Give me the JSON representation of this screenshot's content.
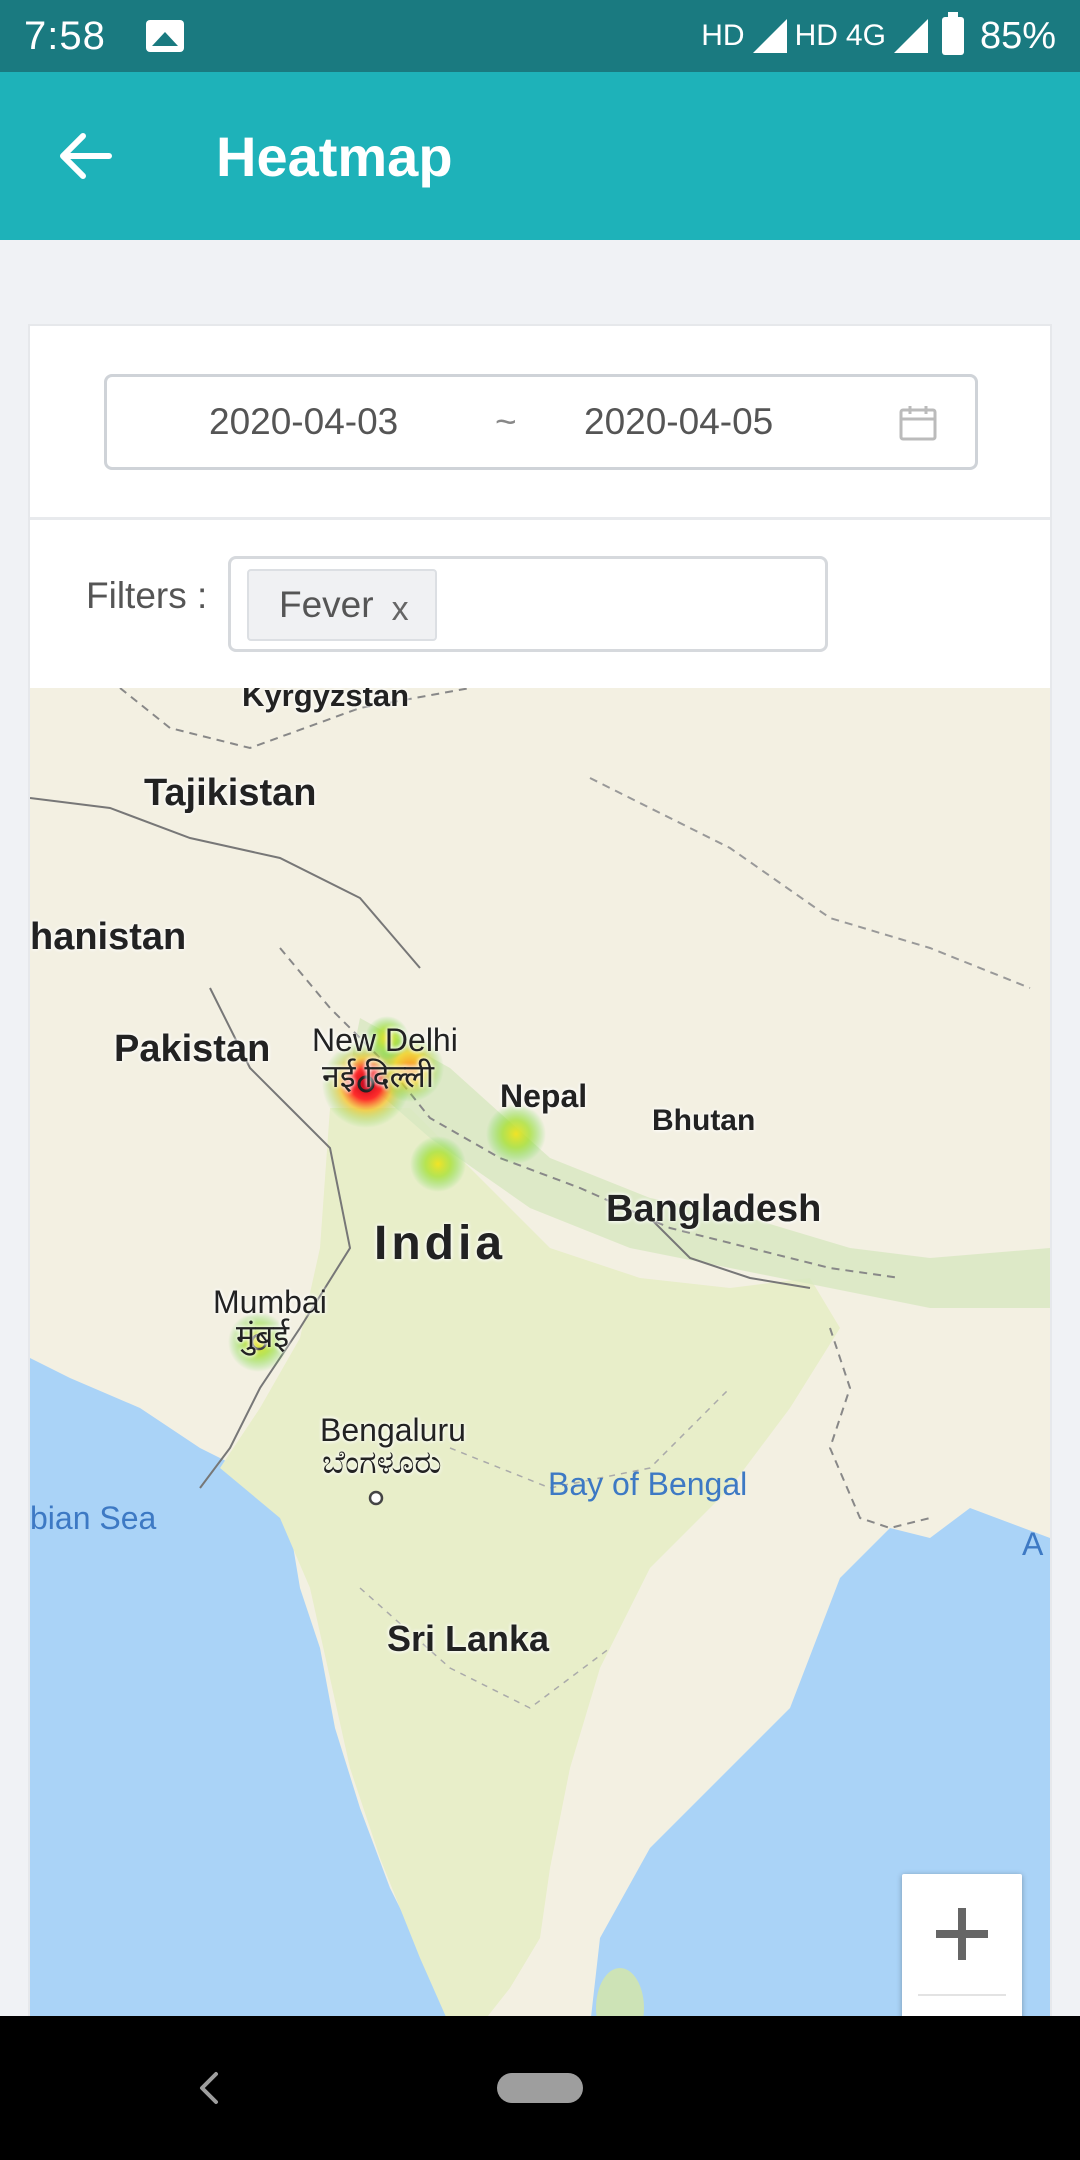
{
  "status_bar": {
    "time": "7:58",
    "network": "HD",
    "network2": "HD",
    "network3": "4G",
    "battery": "85%"
  },
  "app_bar": {
    "title": "Heatmap",
    "back_icon": "arrow-left-icon"
  },
  "date_range": {
    "start": "2020-04-03",
    "separator": "~",
    "end": "2020-04-05",
    "icon": "calendar-icon"
  },
  "filters": {
    "label": "Filters :",
    "chips": [
      {
        "label": "Fever",
        "close": "x"
      }
    ]
  },
  "map": {
    "labels": {
      "kyrgyzstan": "Kyrgyzstan",
      "tajikistan": "Tajikistan",
      "afghanistan": "hanistan",
      "pakistan": "Pakistan",
      "new_delhi": "New Delhi",
      "new_delhi_local": "नई दिल्ली",
      "nepal": "Nepal",
      "bhutan": "Bhutan",
      "bangladesh": "Bangladesh",
      "india": "India",
      "mumbai": "Mumbai",
      "mumbai_local": "मुंबई",
      "bengaluru": "Bengaluru",
      "bengaluru_local": "ಬೆಂಗಳೂರು",
      "arabian_sea": "bian Sea",
      "bay_of_bengal": "Bay of Bengal",
      "sri_lanka": "Sri Lanka",
      "andaman": "A"
    },
    "hotspot_colors": {
      "high": "#e8202a",
      "mid": "#f2c81e",
      "low": "#4fd43c"
    },
    "zoom_in_label": "+"
  },
  "nav_bar": {
    "back_icon": "nav-back-icon",
    "home_icon": "nav-home-pill"
  }
}
